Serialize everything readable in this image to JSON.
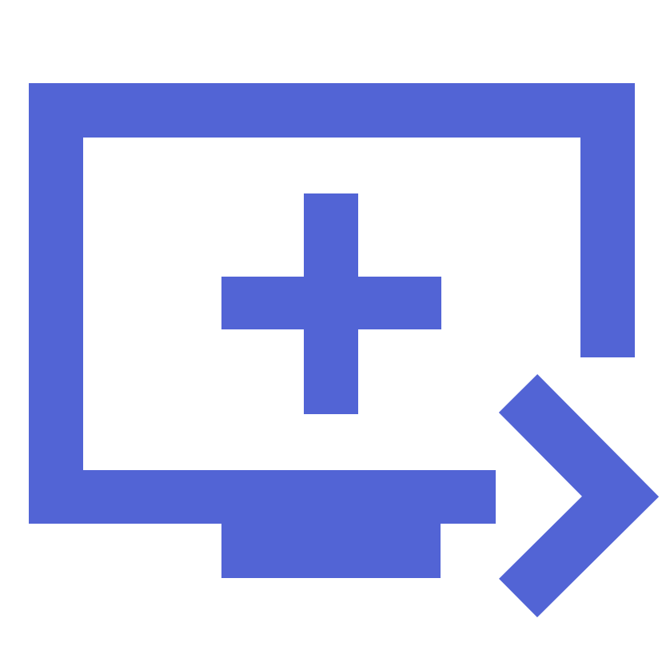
{
  "icon": {
    "name": "add-to-screen-icon",
    "parts": [
      "monitor",
      "plus",
      "chevron-right"
    ],
    "color": "#5264d5",
    "background": "#ffffff"
  }
}
